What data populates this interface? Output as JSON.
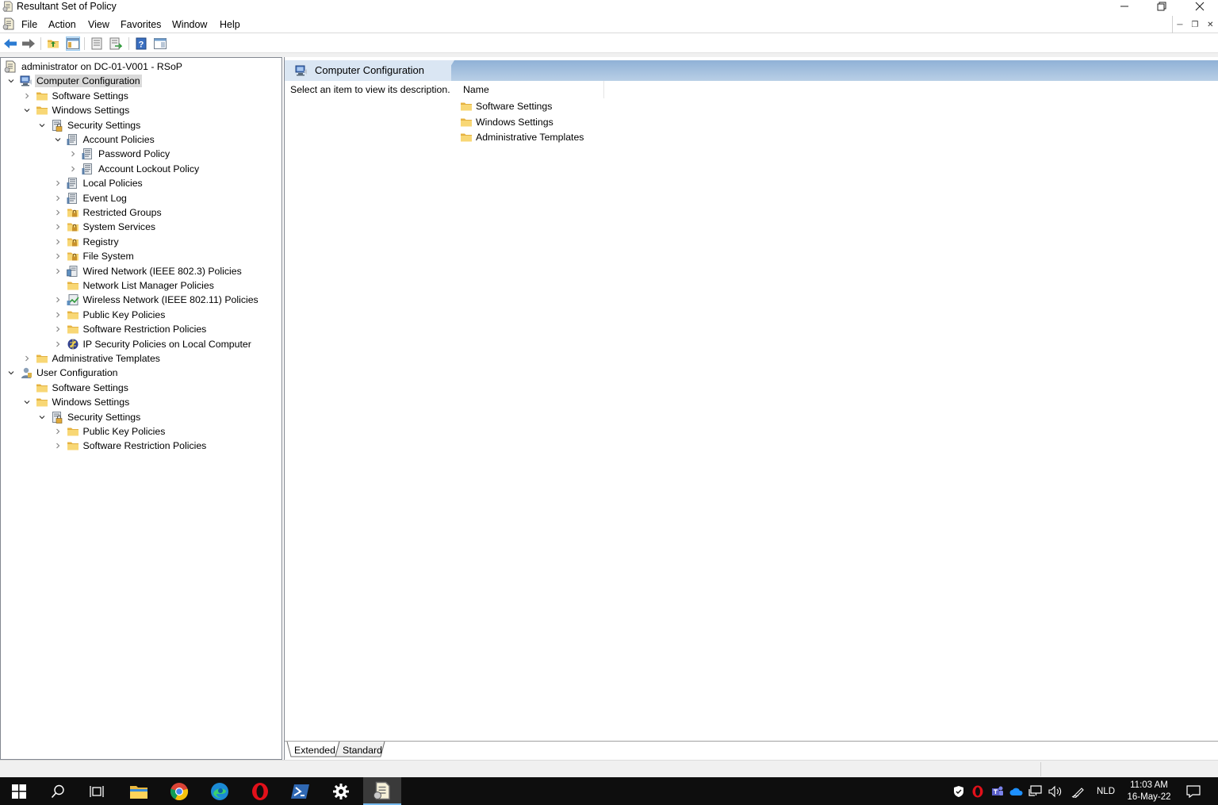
{
  "window": {
    "title": "Resultant Set of Policy"
  },
  "menu": {
    "items": [
      "File",
      "Action",
      "View",
      "Favorites",
      "Window",
      "Help"
    ]
  },
  "toolbar": {
    "buttons": [
      "back-arrow-icon",
      "forward-arrow-icon",
      "up-folder-icon",
      "show-hide-tree-icon",
      "export-list-icon",
      "properties-icon",
      "help-icon",
      "show-hide-action-pane-icon"
    ]
  },
  "tree": {
    "root": "administrator on DC-01-V001 - RSoP",
    "nodes": [
      {
        "label": "Computer Configuration",
        "selected": true
      },
      {
        "label": "Software Settings"
      },
      {
        "label": "Windows Settings"
      },
      {
        "label": "Security Settings"
      },
      {
        "label": "Account Policies"
      },
      {
        "label": "Password Policy"
      },
      {
        "label": "Account Lockout Policy"
      },
      {
        "label": "Local Policies"
      },
      {
        "label": "Event Log"
      },
      {
        "label": "Restricted Groups"
      },
      {
        "label": "System Services"
      },
      {
        "label": "Registry"
      },
      {
        "label": "File System"
      },
      {
        "label": "Wired Network (IEEE 802.3) Policies"
      },
      {
        "label": "Network List Manager Policies"
      },
      {
        "label": "Wireless Network (IEEE 802.11) Policies"
      },
      {
        "label": "Public Key Policies"
      },
      {
        "label": "Software Restriction Policies"
      },
      {
        "label": "IP Security Policies on Local Computer"
      },
      {
        "label": "Administrative Templates"
      },
      {
        "label": "User Configuration"
      },
      {
        "label": "Software Settings"
      },
      {
        "label": "Windows Settings"
      },
      {
        "label": "Security Settings"
      },
      {
        "label": "Public Key Policies"
      },
      {
        "label": "Software Restriction Policies"
      }
    ]
  },
  "details": {
    "header_title": "Computer Configuration",
    "description": "Select an item to view its description.",
    "column_name": "Name",
    "items": [
      "Software Settings",
      "Windows Settings",
      "Administrative Templates"
    ],
    "tabs": [
      "Extended",
      "Standard"
    ],
    "active_tab": "Extended"
  },
  "taskbar": {
    "language": "NLD",
    "time": "11:03 AM",
    "date": "16-May-22"
  },
  "colors": {
    "folder": "#f5c85a",
    "header_blue": "#8fb1d6",
    "taskbar": "#0e0e0e",
    "selection": "#d9d9d9"
  }
}
